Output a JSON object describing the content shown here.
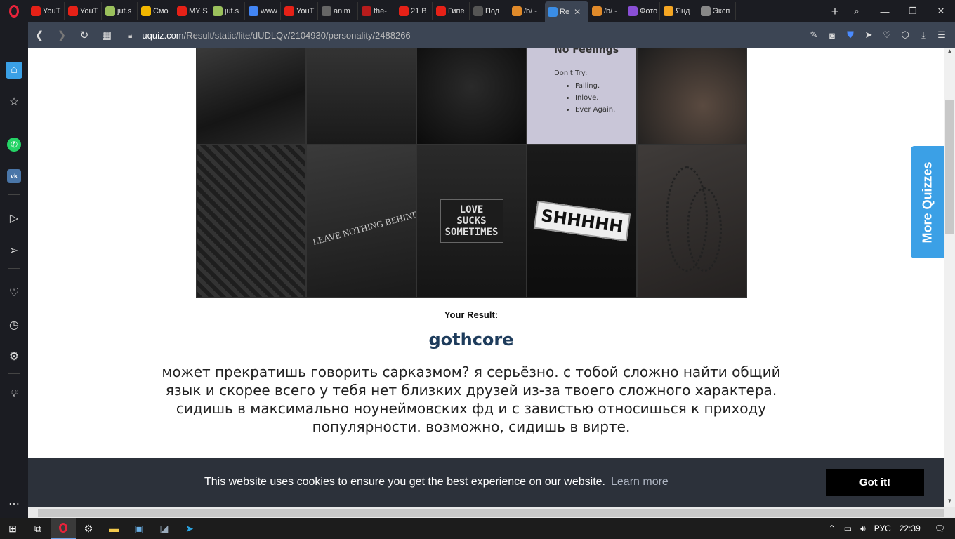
{
  "browser": {
    "tabs": [
      {
        "label": "YouT",
        "color": "#e62117",
        "icon": "youtube-icon"
      },
      {
        "label": "YouT",
        "color": "#e62117",
        "icon": "youtube-icon"
      },
      {
        "label": "jut.s",
        "color": "#9bc15c",
        "icon": "jutsu-icon"
      },
      {
        "label": "Смо",
        "color": "#f2b700",
        "icon": "a-icon"
      },
      {
        "label": "MY S",
        "color": "#e62117",
        "icon": "youtube-icon"
      },
      {
        "label": "jut.s",
        "color": "#9bc15c",
        "icon": "jutsu-icon"
      },
      {
        "label": "www",
        "color": "#4285f4",
        "icon": "google-icon"
      },
      {
        "label": "YouT",
        "color": "#e62117",
        "icon": "youtube-icon"
      },
      {
        "label": "anim",
        "color": "#666666",
        "icon": "avatar-icon"
      },
      {
        "label": "the-",
        "color": "#b81c1c",
        "icon": "book-icon"
      },
      {
        "label": "21 В",
        "color": "#e62117",
        "icon": "youtube-icon"
      },
      {
        "label": "Гипе",
        "color": "#e62117",
        "icon": "youtube-icon"
      },
      {
        "label": "Под",
        "color": "#555555",
        "icon": "steam-icon"
      },
      {
        "label": "/b/ -",
        "color": "#e08a2a",
        "icon": "bolt-icon"
      },
      {
        "label": "Re",
        "color": "#3a8de6",
        "icon": "uquiz-icon",
        "active": true
      },
      {
        "label": "/b/ -",
        "color": "#e08a2a",
        "icon": "bolt-icon"
      },
      {
        "label": "Фото",
        "color": "#8a4fd6",
        "icon": "photo-icon"
      },
      {
        "label": "Янд",
        "color": "#f5a623",
        "icon": "yandex-icon"
      },
      {
        "label": "Эксп",
        "color": "#888888",
        "icon": "grid-icon"
      }
    ],
    "url_domain": "uquiz.com",
    "url_path": "/Result/static/lite/dUDLQv/2104930/personality/2488266"
  },
  "grid_text": {
    "nofeelings_title": "No Feelings",
    "nofeelings_sub": "Don't Try:",
    "nofeelings_items": [
      "Falling.",
      "Inlove.",
      "Ever Again."
    ],
    "leave": "LEAVE NOTHING BEHIND",
    "love": "LOVE SUCKS SOMETIMES",
    "plate": "SHHHHH"
  },
  "result": {
    "label": "Your Result:",
    "name": "gothcore",
    "description": "может прекратишь говорить сарказмом? я серьёзно. с тобой сложно найти общий язык и скорее всего у тебя нет близких друзей из-за твоего сложного характера. сидишь в максимально ноунеймовских фд и с завистью относишься к приходу популярности. возможно, сидишь в вирте."
  },
  "sidebar_tab": {
    "label": "More Quizzes"
  },
  "cookie": {
    "message": "This website uses cookies to ensure you get the best experience on our website.",
    "learn_more": "Learn more",
    "accept": "Got it!"
  },
  "taskbar": {
    "lang": "РУС",
    "time": "22:39"
  }
}
